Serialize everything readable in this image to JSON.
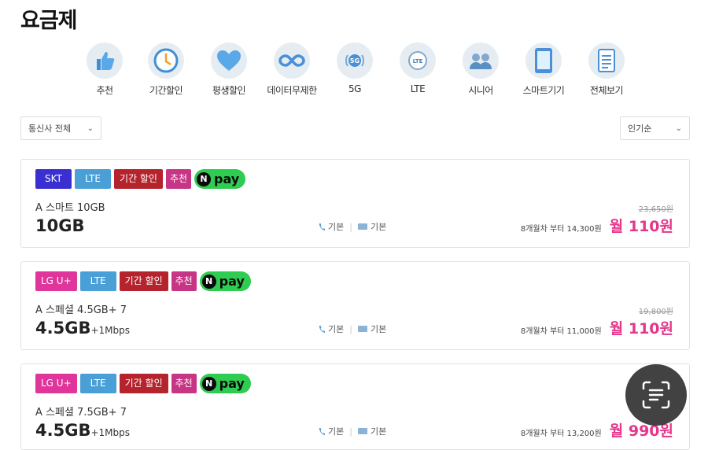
{
  "page": {
    "title": "요금제"
  },
  "categories": [
    {
      "label": "추천",
      "icon": "thumbs-up-icon"
    },
    {
      "label": "기간할인",
      "icon": "clock-icon"
    },
    {
      "label": "평생할인",
      "icon": "heart-icon"
    },
    {
      "label": "데이터무제한",
      "icon": "infinity-icon"
    },
    {
      "label": "5G",
      "icon": "5g-icon"
    },
    {
      "label": "LTE",
      "icon": "lte-icon"
    },
    {
      "label": "시니어",
      "icon": "senior-icon"
    },
    {
      "label": "스마트기기",
      "icon": "tablet-icon"
    },
    {
      "label": "전체보기",
      "icon": "document-icon"
    }
  ],
  "filters": {
    "carrier_label": "통신사 전체",
    "sort_label": "인기순"
  },
  "npay_label": "pay",
  "npay_n": "N",
  "colors": {
    "skt": "#3a2fd0",
    "lgu": "#e0359a",
    "lte": "#4a9fd6",
    "period": "#b5232d",
    "recommend": "#c73585",
    "price": "#e4378a"
  },
  "plans": [
    {
      "tags": {
        "carrier": "SKT",
        "network": "LTE",
        "discount": "기간 할인",
        "recommend": "추천"
      },
      "name": "A 스마트 10GB",
      "data": "10GB",
      "data_extra": "",
      "call": "기본",
      "msg": "기본",
      "original_price": "23,650원",
      "promo_text": "8개월차 부터 14,300원",
      "price": "월 110원"
    },
    {
      "tags": {
        "carrier": "LG U+",
        "network": "LTE",
        "discount": "기간 할인",
        "recommend": "추천"
      },
      "name": "A 스페셜 4.5GB+ 7",
      "data": "4.5GB",
      "data_extra": "+1Mbps",
      "call": "기본",
      "msg": "기본",
      "original_price": "19,800원",
      "promo_text": "8개월차 부터 11,000원",
      "price": "월 110원"
    },
    {
      "tags": {
        "carrier": "LG U+",
        "network": "LTE",
        "discount": "기간 할인",
        "recommend": "추천"
      },
      "name": "A 스페셜 7.5GB+ 7",
      "data": "4.5GB",
      "data_extra": "+1Mbps",
      "call": "기본",
      "msg": "기본",
      "original_price": "",
      "promo_text": "8개월차 부터 13,200원",
      "price": "월 990원"
    }
  ]
}
